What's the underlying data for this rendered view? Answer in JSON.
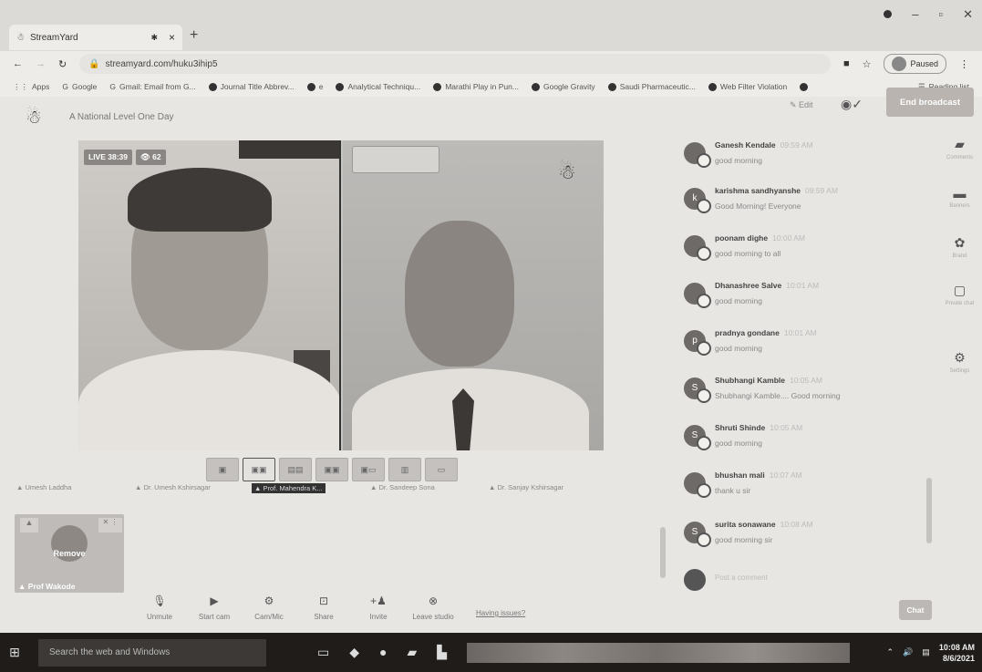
{
  "browser": {
    "tab_title": "StreamYard",
    "tab_close": "×",
    "new_tab": "+",
    "url": "streamyard.com/huku3ihip5",
    "profile_status": "Paused",
    "bookmarks": [
      {
        "label": "Apps"
      },
      {
        "label": "Google"
      },
      {
        "label": "Gmail: Email from G..."
      },
      {
        "label": "Journal Title Abbrev..."
      },
      {
        "label": "e"
      },
      {
        "label": "Analytical Techniqu..."
      },
      {
        "label": "Marathi Play in Pun..."
      },
      {
        "label": "Google Gravity"
      },
      {
        "label": "Saudi Pharmaceutic..."
      },
      {
        "label": "Web Filter Violation"
      }
    ],
    "reading_list": "Reading list"
  },
  "studio": {
    "title": "A National Level One Day",
    "edit_label": "Edit",
    "end_broadcast": "End broadcast",
    "live_badge": "LIVE 38:39",
    "viewers": "62",
    "stage_names": [
      {
        "label": "Umesh Laddha"
      },
      {
        "label": "Dr. Umesh Kshirsagar"
      },
      {
        "label": "Prof. Mahendra K..."
      },
      {
        "label": "Dr. Sandeep Sona"
      },
      {
        "label": "Dr. Sanjay Kshirsagar"
      }
    ],
    "backstage": {
      "remove_label": "Remove",
      "name": "Prof Wakode"
    },
    "toolbar": [
      {
        "label": "Unmute",
        "icon": "mic-off-icon"
      },
      {
        "label": "Start cam",
        "icon": "camera-off-icon"
      },
      {
        "label": "Cam/Mic",
        "icon": "gear-icon"
      },
      {
        "label": "Share",
        "icon": "share-screen-icon"
      },
      {
        "label": "Invite",
        "icon": "add-person-icon"
      },
      {
        "label": "Leave studio",
        "icon": "close-circle-icon"
      }
    ],
    "help_link": "Having issues?"
  },
  "chat": {
    "messages": [
      {
        "author": "Ganesh Kendale",
        "time": "09:59 AM",
        "text": "good morning",
        "initial": ""
      },
      {
        "author": "karishma sandhyanshe",
        "time": "09:59 AM",
        "text": "Good Morning! Everyone",
        "initial": "k"
      },
      {
        "author": "poonam dighe",
        "time": "10:00 AM",
        "text": "good morning to all",
        "initial": ""
      },
      {
        "author": "Dhanashree Salve",
        "time": "10:01 AM",
        "text": "good morning",
        "initial": ""
      },
      {
        "author": "pradnya gondane",
        "time": "10:01 AM",
        "text": "good morning",
        "initial": "p"
      },
      {
        "author": "Shubhangi Kamble",
        "time": "10:05 AM",
        "text": "Shubhangi Kamble.... Good morning",
        "initial": "S"
      },
      {
        "author": "Shruti Shinde",
        "time": "10:05 AM",
        "text": "good morning",
        "initial": "S"
      },
      {
        "author": "bhushan mali",
        "time": "10:07 AM",
        "text": "thank u sir",
        "initial": ""
      },
      {
        "author": "surita sonawane",
        "time": "10:08 AM",
        "text": "good morning sir",
        "initial": "S"
      }
    ],
    "input_placeholder": "Post a comment",
    "send_label": "Chat"
  },
  "sidebar": [
    {
      "label": "Comments",
      "icon": "comment-icon"
    },
    {
      "label": "Banners",
      "icon": "banner-icon"
    },
    {
      "label": "Brand",
      "icon": "palette-icon"
    },
    {
      "label": "Private chat",
      "icon": "chat-icon"
    },
    {
      "label": "Settings",
      "icon": "gear-icon"
    }
  ],
  "taskbar": {
    "search_placeholder": "Search the web and Windows",
    "time": "10:08 AM",
    "date": "8/6/2021"
  }
}
